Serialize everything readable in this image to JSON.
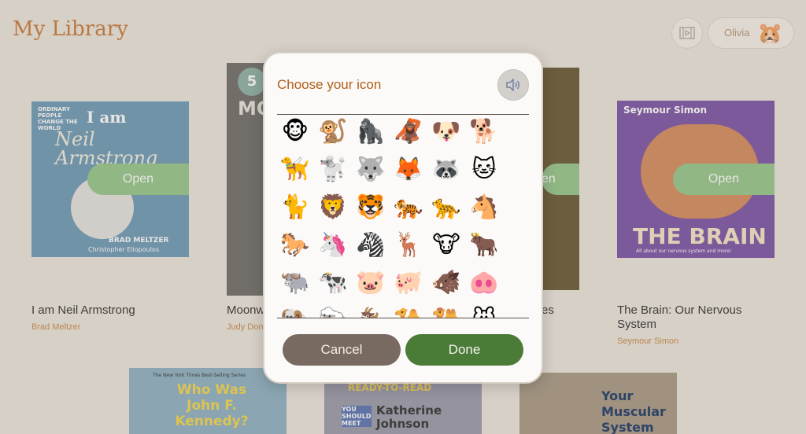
{
  "header": {
    "title": "My Library",
    "user_name": "Olivia",
    "avatar_emoji": "🐹"
  },
  "books": [
    {
      "title": "I am Neil Armstrong",
      "author": "Brad Meltzer",
      "cover": {
        "top": "I am",
        "name": "Neil Armstrong",
        "credit1": "BRAD MELTZER",
        "credit2": "Christopher Eliopoulos",
        "series": "ORDINARY PEOPLE CHANGE THE WORLD"
      }
    },
    {
      "title": "Moonw",
      "author": "Judy Don",
      "cover": {
        "badge": "5",
        "big": "MO"
      }
    },
    {
      "title": "es",
      "author": "",
      "cover": {}
    },
    {
      "title": "The Brain: Our Nervous System",
      "author": "Seymour Simon",
      "cover": {
        "author": "Seymour Simon",
        "big": "THE BRAIN",
        "sub": "All about our nervous system and more!"
      }
    },
    {
      "cover": {
        "top": "The New York Times Best-Selling Series",
        "big": "Who Was John F. Kennedy?"
      }
    },
    {
      "cover": {
        "top": "READY-TO-READ",
        "big": "Katherine Johnson",
        "sub": "YOU SHOULD MEET"
      }
    },
    {
      "cover": {
        "big": "Your Muscular System"
      }
    }
  ],
  "open_label": "Open",
  "open_partial": "en",
  "modal": {
    "title": "Choose your icon",
    "cancel_label": "Cancel",
    "done_label": "Done",
    "icons": [
      "🐵",
      "🐒",
      "🦍",
      "🦧",
      "🐶",
      "🐕",
      "🦮",
      "🐩",
      "🐺",
      "🦊",
      "🦝",
      "🐱",
      "🐈",
      "🦁",
      "🐯",
      "🐅",
      "🐆",
      "🐴",
      "🐎",
      "🦄",
      "🦓",
      "🦌",
      "🐮",
      "🐂",
      "🐃",
      "🐄",
      "🐷",
      "🐖",
      "🐗",
      "🐽",
      "🐏",
      "🐑",
      "🐐",
      "🐪",
      "🐫",
      "🐭"
    ]
  },
  "colors": {
    "accent": "#c97a3a",
    "done": "#4a7b37",
    "cancel": "#786a61",
    "open": "#97c78d"
  }
}
